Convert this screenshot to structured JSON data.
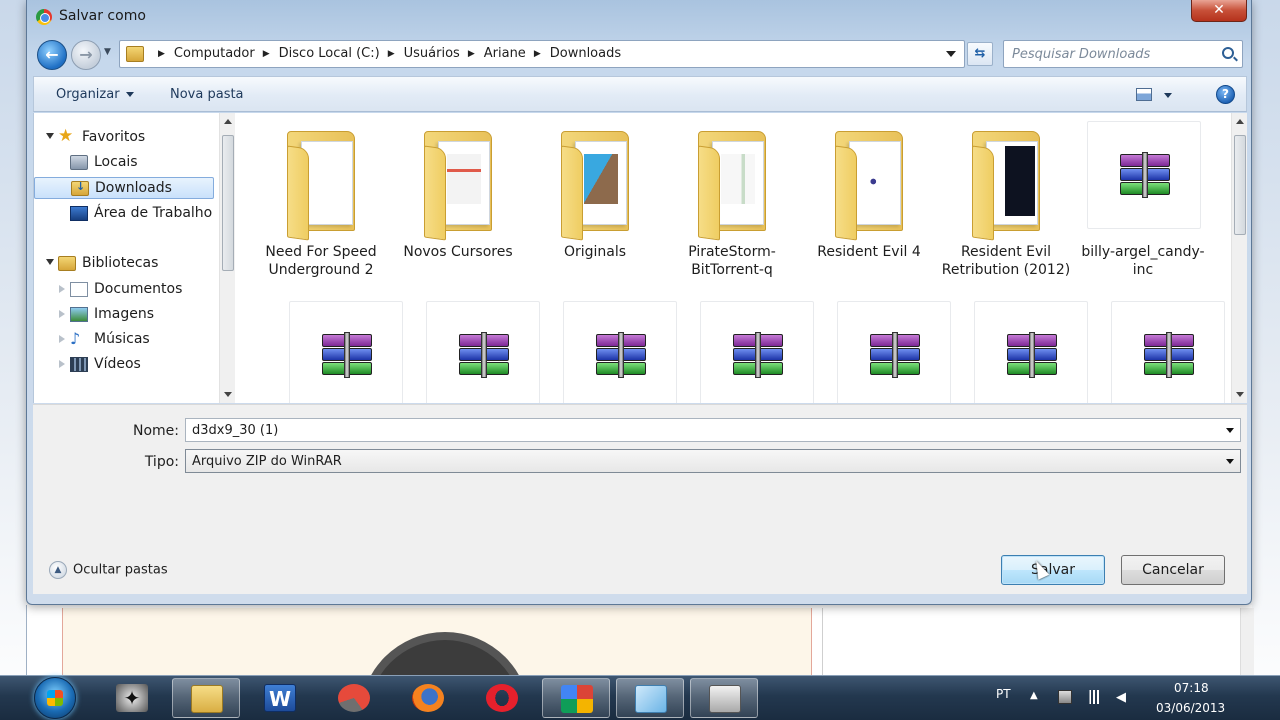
{
  "window": {
    "title": "Salvar como",
    "close_label": "✕"
  },
  "address": {
    "crumbs": [
      "Computador",
      "Disco Local (C:)",
      "Usuários",
      "Ariane",
      "Downloads"
    ],
    "search_placeholder": "Pesquisar Downloads"
  },
  "toolbar": {
    "organize_label": "Organizar",
    "new_folder_label": "Nova pasta",
    "help_label": "?"
  },
  "nav": {
    "favorites_label": "Favoritos",
    "favorites": [
      "Locais",
      "Downloads",
      "Área de Trabalho"
    ],
    "libraries_label": "Bibliotecas",
    "libraries": [
      "Documentos",
      "Imagens",
      "Músicas",
      "Vídeos"
    ],
    "selected": "Downloads"
  },
  "files": {
    "row1": [
      {
        "name": "Need For Speed Underground 2",
        "icon": "folder-icon"
      },
      {
        "name": "Novos Cursores",
        "icon": "folder-icon"
      },
      {
        "name": "Originals",
        "icon": "folder-icon"
      },
      {
        "name": "PirateStorm-BitTorrent-q",
        "icon": "folder-icon"
      },
      {
        "name": "Resident Evil 4",
        "icon": "folder-icon"
      },
      {
        "name": "Resident Evil Retribution (2012)",
        "icon": "folder-icon"
      },
      {
        "name": "billy-argel_candy-inc",
        "icon": "winrar-archive-icon"
      }
    ],
    "row2_count_icons": [
      "winrar-archive-icon",
      "winrar-archive-icon",
      "winrar-archive-icon",
      "winrar-archive-icon",
      "winrar-archive-icon",
      "winrar-archive-icon",
      "winrar-archive-icon"
    ]
  },
  "form": {
    "name_label": "Nome:",
    "name_value": "d3dx9_30 (1)",
    "type_label": "Tipo:",
    "type_value": "Arquivo ZIP do WinRAR",
    "hide_folders_label": "Ocultar pastas",
    "save_label": "Salvar",
    "cancel_label": "Cancelar"
  },
  "taskbar": {
    "language": "PT",
    "time": "07:18",
    "date": "03/06/2013",
    "apps": [
      "counter-strike-icon",
      "file-explorer-icon",
      "word-icon",
      "capture-app-icon",
      "firefox-icon",
      "opera-icon",
      "google-chrome-icon",
      "paint-icon",
      "camera-icon"
    ],
    "word_glyph": "W"
  },
  "colors": {
    "accent": "#3c7fb1",
    "taskbar": "#23384f",
    "folder": "#e8c15a"
  }
}
